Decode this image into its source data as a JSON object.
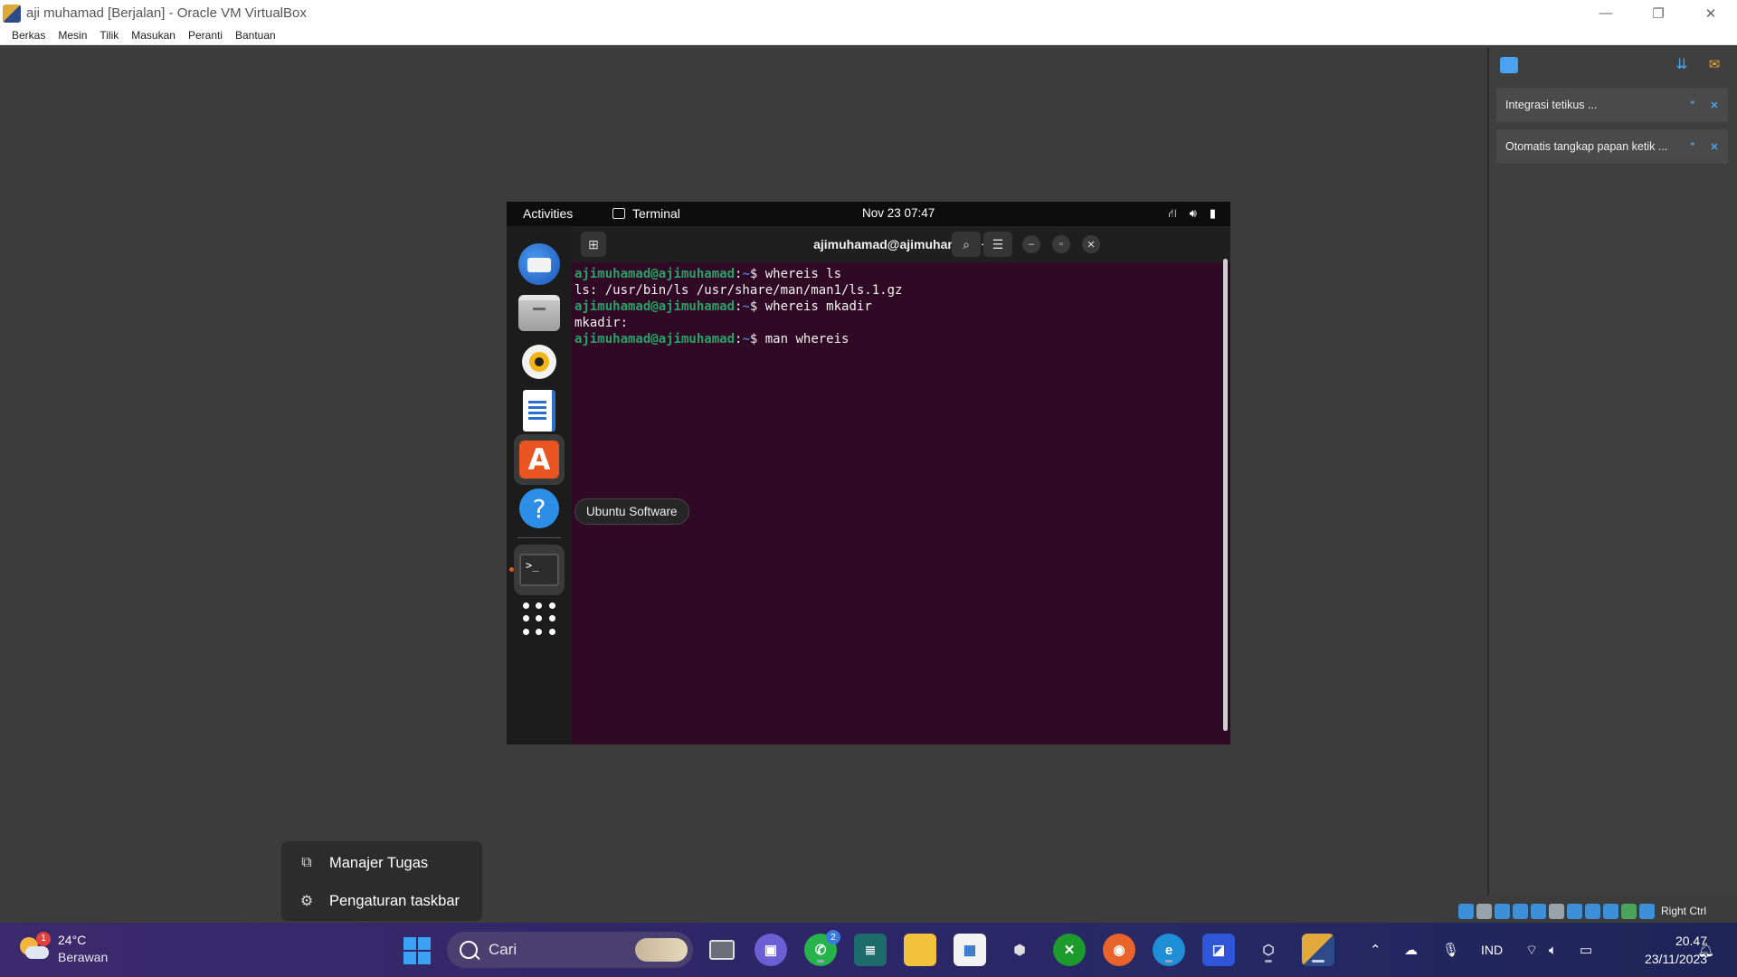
{
  "window": {
    "title": "aji muhamad  [Berjalan] - Oracle VM VirtualBox",
    "minimize": "—",
    "restore": "❐",
    "close": "✕"
  },
  "menubar": [
    "Berkas",
    "Mesin",
    "Tilik",
    "Masukan",
    "Peranti",
    "Bantuan"
  ],
  "notifications": {
    "items": [
      {
        "text": "Integrasi tetikus ..."
      },
      {
        "text": "Otomatis tangkap papan ketik ..."
      }
    ]
  },
  "vm_status": {
    "host_key": "Right Ctrl"
  },
  "gnome": {
    "activities": "Activities",
    "app_name": "Terminal",
    "clock": "Nov 23  07:47",
    "dock_tooltip": "Ubuntu Software"
  },
  "terminal": {
    "title": "ajimuhamad@ajimuhamad: ~",
    "lines": [
      {
        "user": "ajimuhamad@ajimuhamad",
        "path": "~",
        "cmd": "$ whereis ls"
      },
      {
        "output": "ls: /usr/bin/ls /usr/share/man/man1/ls.1.gz"
      },
      {
        "user": "ajimuhamad@ajimuhamad",
        "path": "~",
        "cmd": "$ whereis mkadir"
      },
      {
        "output": "mkadir:"
      },
      {
        "user": "ajimuhamad@ajimuhamad",
        "path": "~",
        "cmd": "$ man whereis"
      }
    ]
  },
  "context_menu": {
    "items": [
      {
        "label": "Manajer Tugas",
        "icon": "task-manager-icon"
      },
      {
        "label": "Pengaturan taskbar",
        "icon": "gear-icon"
      }
    ]
  },
  "taskbar": {
    "weather": {
      "temp": "24°C",
      "condition": "Berawan",
      "badge": "1"
    },
    "search_placeholder": "Cari",
    "whatsapp_badge": "2",
    "language": "IND",
    "time": "20.47",
    "date": "23/11/2023"
  }
}
